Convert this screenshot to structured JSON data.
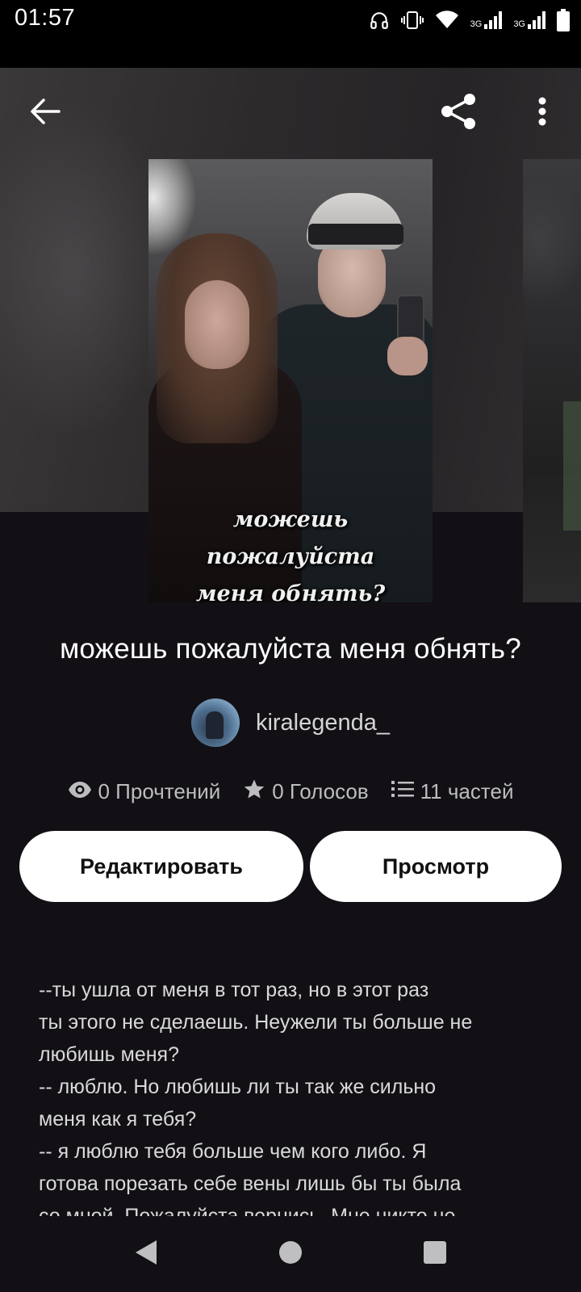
{
  "status_bar": {
    "time": "01:57",
    "icons": [
      "headphones-icon",
      "vibrate-icon",
      "wifi-icon",
      "signal-3g-icon",
      "signal-3g-icon",
      "battery-icon"
    ],
    "network_label_1": "3G",
    "network_label_2": "3G"
  },
  "header": {
    "back_icon": "arrow-left-icon",
    "share_icon": "share-icon",
    "more_icon": "more-vertical-icon"
  },
  "cover": {
    "caption_line1": "можешь пожалуйста",
    "caption_line2": "меня обнять?"
  },
  "story": {
    "title": "можешь пожалуйста меня обнять?",
    "author": "kiralegenda_"
  },
  "stats": {
    "reads": "0 Прочтений",
    "votes": "0 Голосов",
    "parts": "11 частей"
  },
  "actions": {
    "edit_label": "Редактировать",
    "view_label": "Просмотр"
  },
  "description": "--ты ушла от меня в тот раз, но в этот раз\nты этого не сделаешь. Неужели ты больше не\nлюбишь меня?\n-- люблю. Но любишь ли ты так же сильно\nменя как я тебя?\n-- я люблю тебя больше чем кого либо. Я\nготова порезать себе вены лишь бы ты была\nсо мной. Пожалуйста вернись. Мне никто не",
  "colors": {
    "background": "#121014",
    "button_bg": "#ffffff",
    "button_text": "#111111",
    "muted_text": "#bdbdc0"
  }
}
